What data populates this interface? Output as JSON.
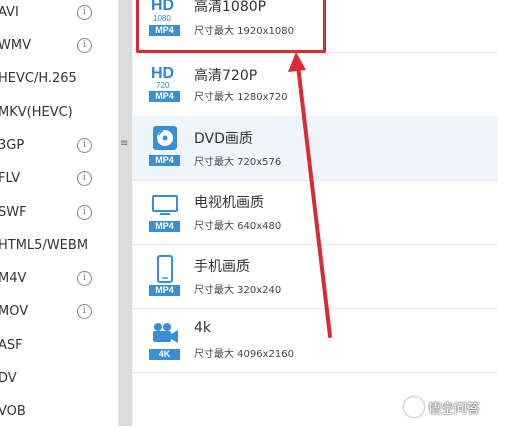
{
  "format_list": [
    {
      "label": "AVI",
      "info": true
    },
    {
      "label": "WMV",
      "info": true
    },
    {
      "label": "HEVC/H.265",
      "info": false
    },
    {
      "label": "MKV(HEVC)",
      "info": false
    },
    {
      "label": "3GP",
      "info": true
    },
    {
      "label": "FLV",
      "info": true
    },
    {
      "label": "SWF",
      "info": true
    },
    {
      "label": "HTML5/WEBM",
      "info": false
    },
    {
      "label": "M4V",
      "info": true
    },
    {
      "label": "MOV",
      "info": true
    },
    {
      "label": "ASF",
      "info": false
    },
    {
      "label": "DV",
      "info": false
    },
    {
      "label": "VOB",
      "info": false
    }
  ],
  "info_glyph": "i",
  "scroll_grip": "≡",
  "presets": [
    {
      "title": "高清1080P",
      "size": "尺寸最大  1920x1080",
      "icon": "hd-1080-icon",
      "icon_text": "HD",
      "icon_sub": "1080",
      "badge": "MP4"
    },
    {
      "title": "高清720P",
      "size": "尺寸最大  1280x720",
      "icon": "hd-720-icon",
      "icon_text": "HD",
      "icon_sub": "720",
      "badge": "MP4"
    },
    {
      "title": "DVD画质",
      "size": "尺寸最大  720x576",
      "icon": "dvd-disc-icon",
      "badge": "MP4"
    },
    {
      "title": "电视机画质",
      "size": "尺寸最大  640x480",
      "icon": "tv-monitor-icon",
      "badge": "MP4"
    },
    {
      "title": "手机画质",
      "size": "尺寸最大  320x240",
      "icon": "mobile-phone-icon",
      "badge": "MP4"
    },
    {
      "title": "4k",
      "size": "尺寸最大  4096x2160",
      "icon": "video-camera-icon",
      "badge": "4K"
    }
  ],
  "selected_preset_index": 2,
  "highlighted_preset_index": 0,
  "watermark": "悟空问答",
  "colors": {
    "accent_blue": "#3a8fd4",
    "highlight_red": "#d92b35",
    "selected_row": "#eef6fb"
  }
}
